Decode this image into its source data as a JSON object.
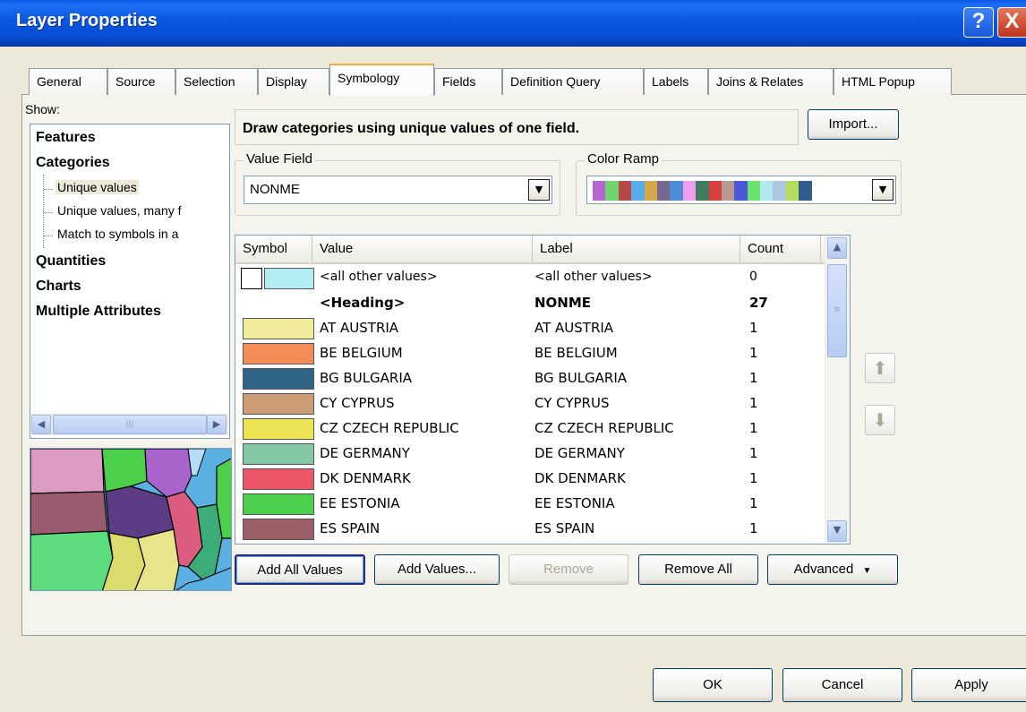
{
  "window": {
    "title": "Layer Properties",
    "help_label": "?",
    "close_label": "X"
  },
  "tabs": [
    {
      "label": "General"
    },
    {
      "label": "Source"
    },
    {
      "label": "Selection"
    },
    {
      "label": "Display"
    },
    {
      "label": "Symbology"
    },
    {
      "label": "Fields"
    },
    {
      "label": "Definition Query"
    },
    {
      "label": "Labels"
    },
    {
      "label": "Joins & Relates"
    },
    {
      "label": "HTML Popup"
    }
  ],
  "active_tab": "Symbology",
  "show": {
    "label": "Show:",
    "tree": {
      "features": "Features",
      "categories": "Categories",
      "unique_values": "Unique values",
      "unique_values_many": "Unique values, many f",
      "match_symbols": "Match to symbols in a",
      "quantities": "Quantities",
      "charts": "Charts",
      "multiple_attributes": "Multiple Attributes"
    }
  },
  "description": "Draw categories using unique values of one field.",
  "import_label": "Import...",
  "value_field": {
    "label": "Value Field",
    "value": "NONME"
  },
  "color_ramp": {
    "label": "Color Ramp",
    "colors": [
      "#b664d0",
      "#6fd46f",
      "#b84848",
      "#5aace8",
      "#d4a848",
      "#786890",
      "#4c8cd4",
      "#f09cf0",
      "#407c60",
      "#d44040",
      "#b89890",
      "#4c58d8",
      "#68e46c",
      "#b4e8f0",
      "#acc8e0",
      "#b4dc5c",
      "#2f5c8c"
    ]
  },
  "table": {
    "headers": {
      "symbol": "Symbol",
      "value": "Value",
      "label": "Label",
      "count": "Count"
    },
    "rows": [
      {
        "value": "<all other values>",
        "label": "<all other values>",
        "count": "0",
        "color": "#b4ecf4",
        "type": "other"
      },
      {
        "value": "<Heading>",
        "label": "NONME",
        "count": "27",
        "type": "heading"
      },
      {
        "value": "AT AUSTRIA",
        "label": "AT AUSTRIA",
        "count": "1",
        "color": "#f0ec9c"
      },
      {
        "value": "BE BELGIUM",
        "label": "BE BELGIUM",
        "count": "1",
        "color": "#f48c58"
      },
      {
        "value": "BG BULGARIA",
        "label": "BG BULGARIA",
        "count": "1",
        "color": "#306484"
      },
      {
        "value": "CY CYPRUS",
        "label": "CY CYPRUS",
        "count": "1",
        "color": "#cc9c74"
      },
      {
        "value": "CZ CZECH REPUBLIC",
        "label": "CZ CZECH REPUBLIC",
        "count": "1",
        "color": "#ece454"
      },
      {
        "value": "DE GERMANY",
        "label": "DE GERMANY",
        "count": "1",
        "color": "#84c8a4"
      },
      {
        "value": "DK DENMARK",
        "label": "DK DENMARK",
        "count": "1",
        "color": "#ec5468"
      },
      {
        "value": "EE ESTONIA",
        "label": "EE ESTONIA",
        "count": "1",
        "color": "#4cd04c"
      },
      {
        "value": "ES SPAIN",
        "label": "ES SPAIN",
        "count": "1",
        "color": "#9c6068"
      }
    ]
  },
  "buttons": {
    "add_all": "Add All Values",
    "add_values": "Add Values...",
    "remove": "Remove",
    "remove_all": "Remove All",
    "advanced": "Advanced",
    "ok": "OK",
    "cancel": "Cancel",
    "apply": "Apply"
  }
}
